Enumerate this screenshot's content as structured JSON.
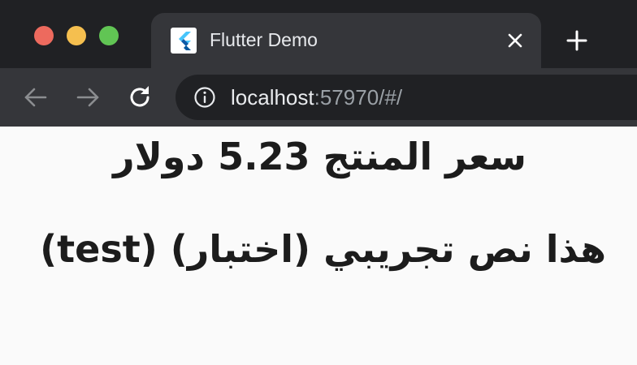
{
  "window": {
    "traffic_lights": {
      "close": "#ed6a5e",
      "minimize": "#f5bf4f",
      "zoom": "#61c554"
    }
  },
  "tab": {
    "title": "Flutter Demo",
    "favicon": "flutter-logo-icon",
    "close_icon": "close-icon"
  },
  "toolbar": {
    "back_icon": "arrow-left-icon",
    "forward_icon": "arrow-right-icon",
    "reload_icon": "reload-icon",
    "new_tab_icon": "plus-icon"
  },
  "address_bar": {
    "info_icon": "info-icon",
    "host": "localhost",
    "rest": ":57970/#/"
  },
  "page": {
    "line1": "سعر المنتج 5.23 دولار",
    "line2": "(test) (هذا نص تجريبي (اختبار"
  },
  "colors": {
    "chrome_dark": "#202124",
    "chrome_toolbar": "#35363a",
    "page_background": "#fafafa",
    "text": "#1c1c1c"
  }
}
